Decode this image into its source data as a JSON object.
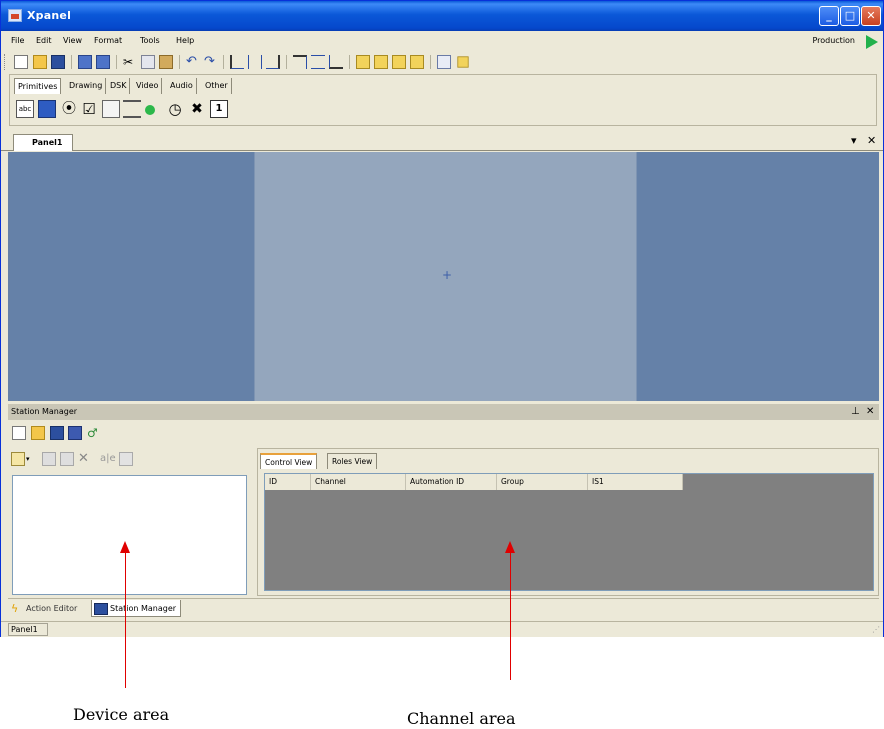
{
  "window": {
    "title": "Xpanel"
  },
  "menu": {
    "items": [
      "File",
      "Edit",
      "View",
      "Format",
      "Tools",
      "Help"
    ],
    "mode_label": "Production"
  },
  "palette": {
    "tabs": [
      "Primitives",
      "Drawing",
      "DSK",
      "Video",
      "Audio",
      "Other"
    ]
  },
  "document": {
    "tab_label": "Panel1"
  },
  "station_manager": {
    "title": "Station Manager",
    "tabs": [
      "Control View",
      "Roles View"
    ],
    "columns": [
      "ID",
      "Channel",
      "Automation ID",
      "Group",
      "IS1"
    ]
  },
  "bottom_tabs": [
    "Action Editor",
    "Station Manager"
  ],
  "status": {
    "panel": "Panel1"
  },
  "annotations": {
    "device_area": "Device area",
    "channel_area": "Channel area"
  },
  "colors": {
    "title_bar": "#0b58d8",
    "canvas_bg": "#6581a8",
    "panel_surface": "#94a6bd",
    "grid_bg": "#808080",
    "arrow": "#e00000"
  }
}
